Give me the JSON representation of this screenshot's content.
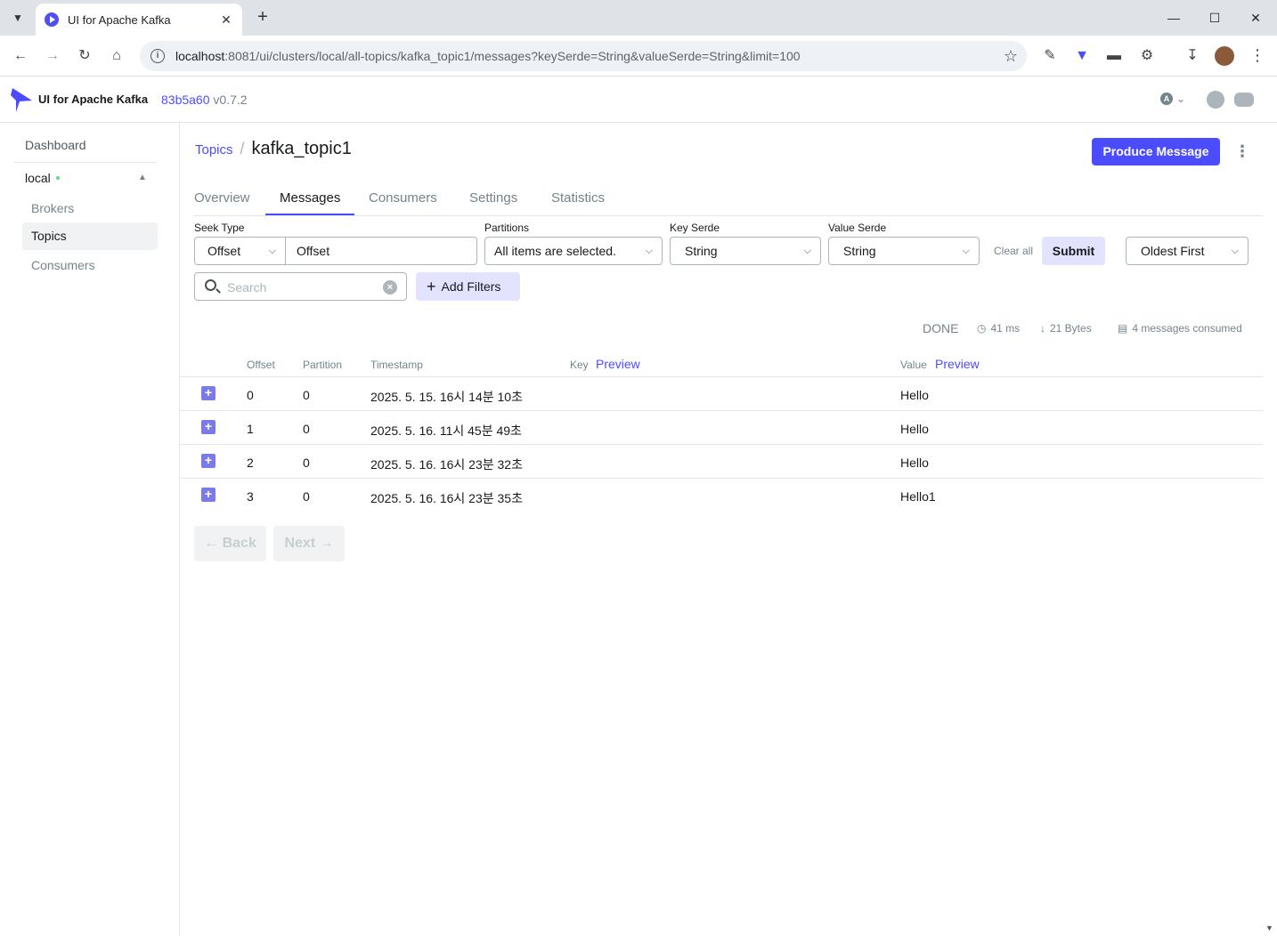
{
  "browser": {
    "tab_title": "UI for Apache Kafka",
    "url_host": "localhost",
    "url_rest": ":8081/ui/clusters/local/all-topics/kafka_topic1/messages?keySerde=String&valueSerde=String&limit=100"
  },
  "app": {
    "title": "UI for Apache Kafka",
    "commit": "83b5a60",
    "version": "v0.7.2",
    "theme_letter": "A"
  },
  "sidebar": {
    "dashboard": "Dashboard",
    "cluster": "local",
    "items": [
      {
        "label": "Brokers"
      },
      {
        "label": "Topics"
      },
      {
        "label": "Consumers"
      }
    ]
  },
  "page": {
    "breadcrumb_link": "Topics",
    "separator": "/",
    "title": "kafka_topic1",
    "produce_label": "Produce Message"
  },
  "tabs": [
    {
      "label": "Overview"
    },
    {
      "label": "Messages"
    },
    {
      "label": "Consumers"
    },
    {
      "label": "Settings"
    },
    {
      "label": "Statistics"
    }
  ],
  "filters": {
    "seek_type_label": "Seek Type",
    "seek_type_value": "Offset",
    "offset_value": "Offset",
    "partitions_label": "Partitions",
    "partitions_value": "All items are selected.",
    "key_serde_label": "Key Serde",
    "key_serde_value": "String",
    "value_serde_label": "Value Serde",
    "value_serde_value": "String",
    "clear_all": "Clear all",
    "submit": "Submit",
    "sort_value": "Oldest First",
    "search_placeholder": "Search",
    "add_filters": "Add Filters"
  },
  "stats": {
    "status": "DONE",
    "elapsed": "41 ms",
    "bytes": "21 Bytes",
    "consumed": "4 messages consumed"
  },
  "table": {
    "headers": {
      "offset": "Offset",
      "partition": "Partition",
      "timestamp": "Timestamp",
      "key": "Key",
      "value": "Value",
      "preview": "Preview"
    },
    "rows": [
      {
        "offset": "0",
        "partition": "0",
        "timestamp": "2025. 5. 15. 16시 14분 10초",
        "key": "",
        "value": "Hello"
      },
      {
        "offset": "1",
        "partition": "0",
        "timestamp": "2025. 5. 16. 11시 45분 49초",
        "key": "",
        "value": "Hello"
      },
      {
        "offset": "2",
        "partition": "0",
        "timestamp": "2025. 5. 16. 16시 23분 32초",
        "key": "",
        "value": "Hello"
      },
      {
        "offset": "3",
        "partition": "0",
        "timestamp": "2025. 5. 16. 16시 23분 35초",
        "key": "",
        "value": "Hello1"
      }
    ]
  },
  "pagination": {
    "back": "← Back",
    "next": "Next →"
  },
  "colors": {
    "accent": "#4c4cff",
    "accent_light": "#e3e3ff",
    "online": "#5cd685"
  }
}
